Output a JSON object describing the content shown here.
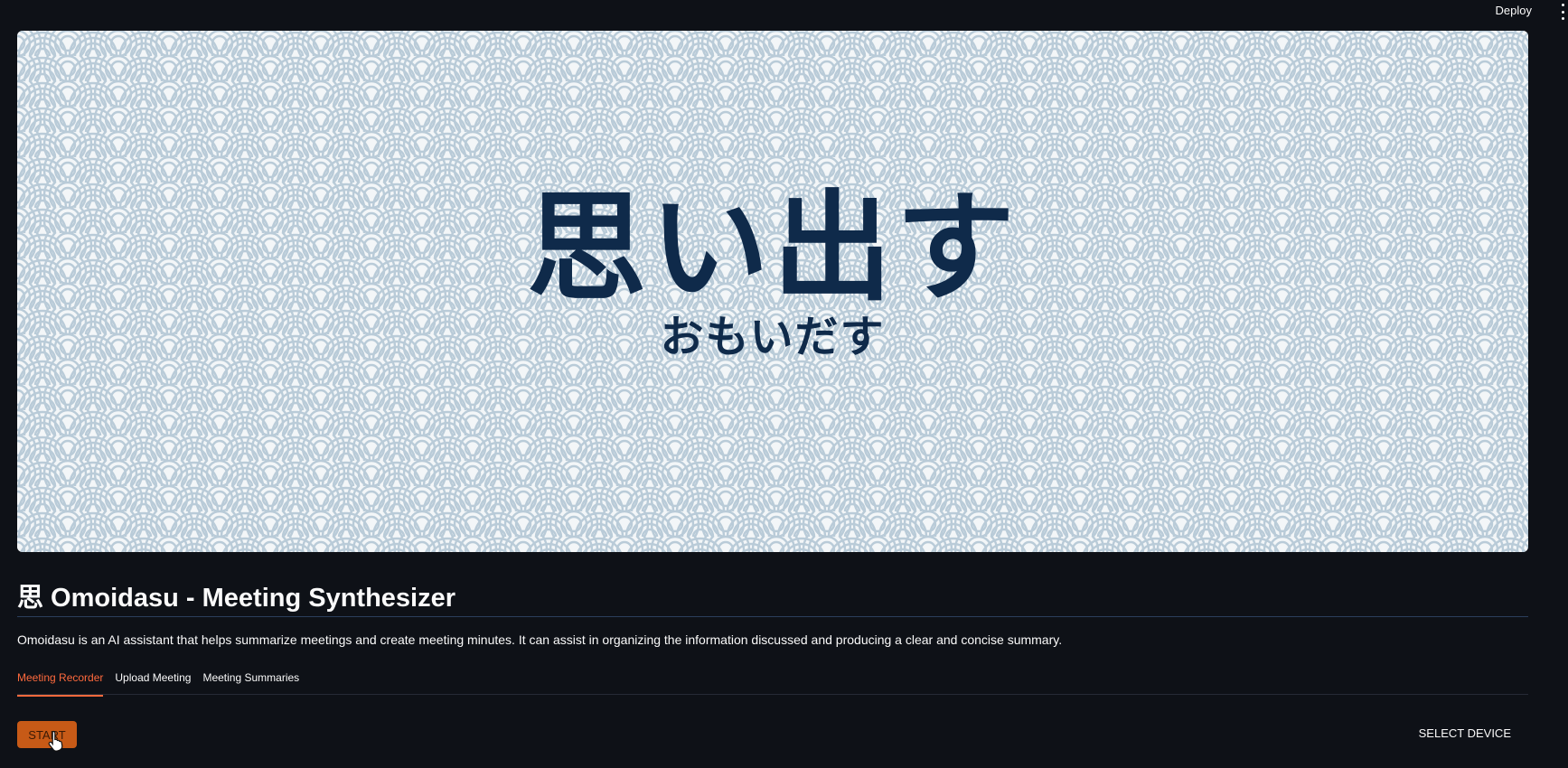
{
  "topbar": {
    "deploy_label": "Deploy",
    "menu_icon": "kebab-menu-icon"
  },
  "banner": {
    "main_text": "思い出す",
    "sub_text": "おもいだす",
    "pattern": "seigaiha-wave-pattern",
    "colors": {
      "background": "#f3f6f8",
      "wave": "#b9cbd8",
      "text": "#0f2a4a"
    }
  },
  "header": {
    "title": "思 Omoidasu - Meeting Synthesizer",
    "description": "Omoidasu is an AI assistant that helps summarize meetings and create meeting minutes. It can assist in organizing the information discussed and producing a clear and concise summary."
  },
  "tabs": [
    {
      "label": "Meeting Recorder",
      "active": true
    },
    {
      "label": "Upload Meeting",
      "active": false
    },
    {
      "label": "Meeting Summaries",
      "active": false
    }
  ],
  "recorder": {
    "start_label": "START",
    "select_device_label": "SELECT DEVICE"
  },
  "colors": {
    "app_background": "#0e1117",
    "accent": "#ff6a3d",
    "button": "#c75a17"
  }
}
